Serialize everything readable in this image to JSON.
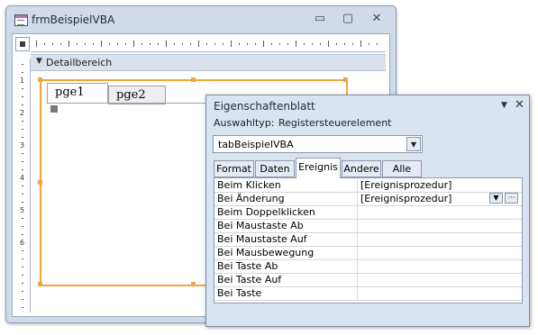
{
  "form_window": {
    "title": "frmBeispielVBA",
    "minimize_glyph": "▭",
    "maximize_glyph": "▢",
    "close_glyph": "✕",
    "section_label": "Detailbereich",
    "section_icon": "▼",
    "tabs": [
      {
        "label": "pge1",
        "selected": true
      },
      {
        "label": "pge2",
        "selected": false
      }
    ],
    "ruler_numbers": [
      "1",
      "2",
      "3",
      "4",
      "5",
      "6"
    ]
  },
  "property_sheet": {
    "title": "Eigenschaftenblatt",
    "dropdown_glyph": "▼",
    "close_glyph": "✕",
    "selection_type_label": "Auswahltyp:",
    "selection_type_value": "Registersteuerelement",
    "object_name": "tabBeispielVBA",
    "select_arrow": "▼",
    "tabs": [
      {
        "label": "Format"
      },
      {
        "label": "Daten"
      },
      {
        "label": "Ereignis",
        "active": true
      },
      {
        "label": "Andere"
      },
      {
        "label": "Alle"
      }
    ],
    "rows": [
      {
        "name": "Beim Klicken",
        "value": "[Ereignisprozedur]"
      },
      {
        "name": "Bei Änderung",
        "value": "[Ereignisprozedur]"
      },
      {
        "name": "Beim Doppelklicken",
        "value": ""
      },
      {
        "name": "Bei Maustaste Ab",
        "value": ""
      },
      {
        "name": "Bei Maustaste Auf",
        "value": ""
      },
      {
        "name": "Bei Mausbewegung",
        "value": ""
      },
      {
        "name": "Bei Taste Ab",
        "value": ""
      },
      {
        "name": "Bei Taste Auf",
        "value": ""
      },
      {
        "name": "Bei Taste",
        "value": ""
      }
    ],
    "row_dropdown_glyph": "▼",
    "row_builder_glyph": "···"
  },
  "colors": {
    "selection_accent": "#f3a43a",
    "window_frame": "#cfdbe8",
    "property_panel": "#d8e4f2"
  }
}
